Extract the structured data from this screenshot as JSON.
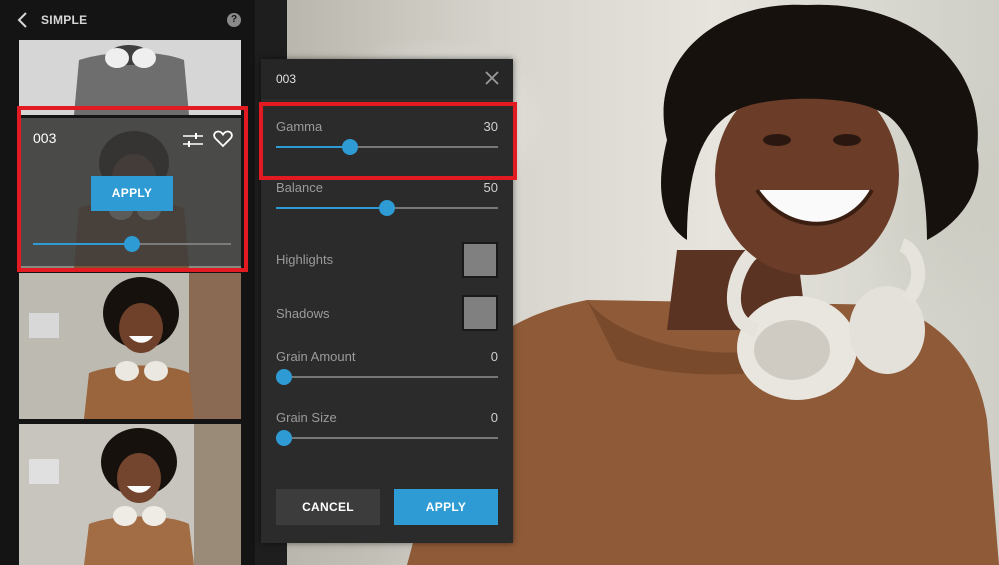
{
  "sidebar": {
    "title": "SIMPLE",
    "help_glyph": "?",
    "active_preset": {
      "name": "003",
      "apply_label": "APPLY",
      "strength_fraction": 0.5
    }
  },
  "panel": {
    "title": "003",
    "sliders": [
      {
        "label": "Gamma",
        "value": "30",
        "fraction": 0.32
      },
      {
        "label": "Balance",
        "value": "50",
        "fraction": 0.5
      },
      {
        "label": "Grain Amount",
        "value": "0",
        "fraction": 0.0
      },
      {
        "label": "Grain Size",
        "value": "0",
        "fraction": 0.0
      }
    ],
    "swatches": [
      {
        "label": "Highlights",
        "color": "#808080"
      },
      {
        "label": "Shadows",
        "color": "#808080"
      }
    ],
    "cancel_label": "CANCEL",
    "apply_label": "APPLY"
  },
  "colors": {
    "accent": "#2f9bd4",
    "highlight": "#e21b23"
  }
}
